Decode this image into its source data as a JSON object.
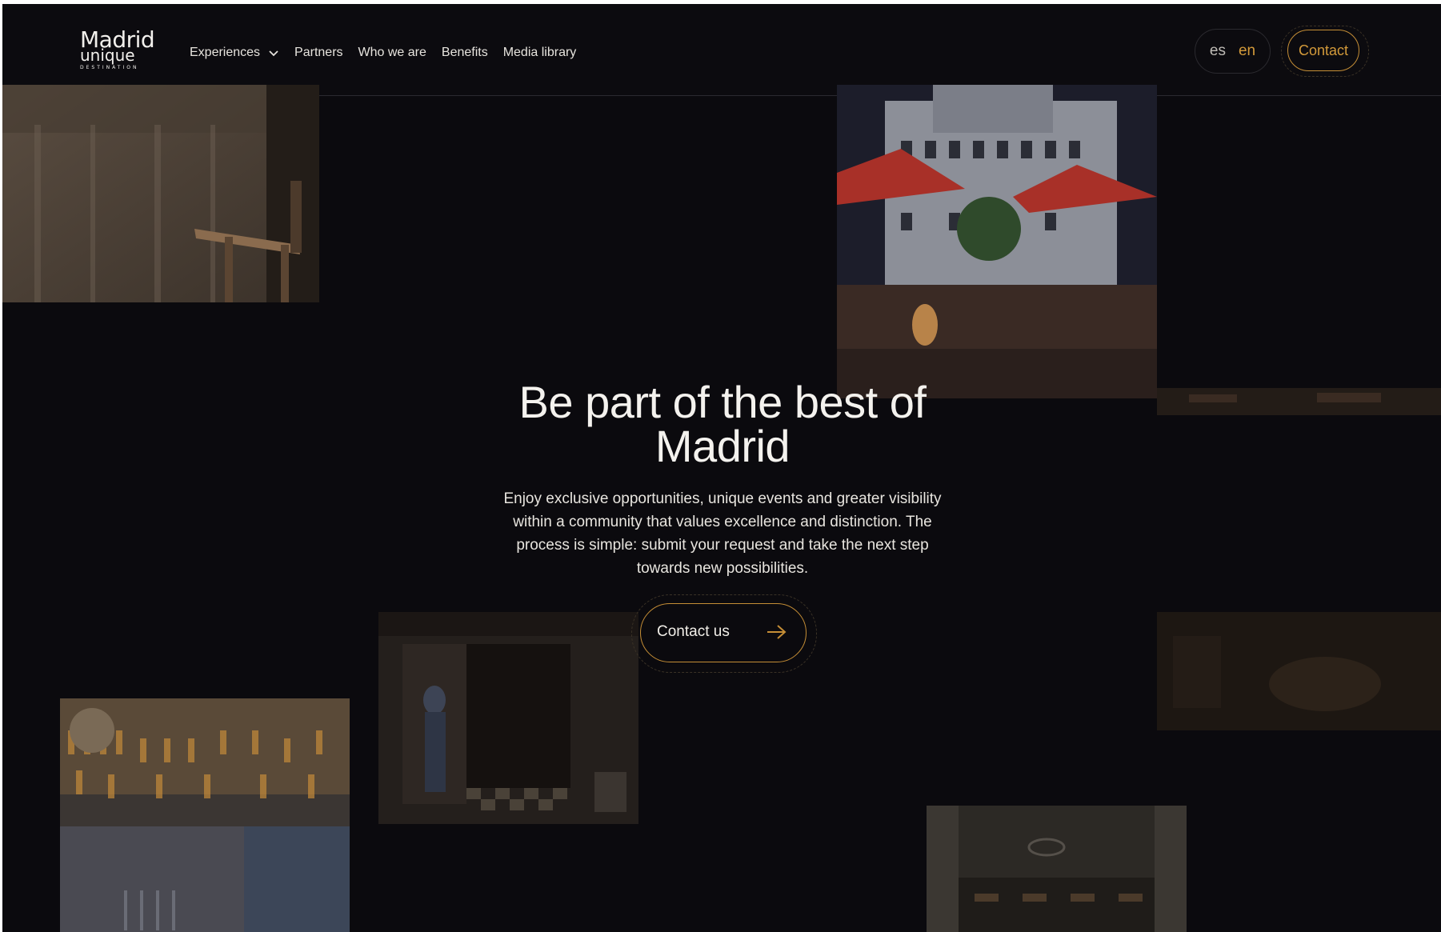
{
  "logo": {
    "main": "Madrid",
    "sub": "unique",
    "tag": "DESTINATION"
  },
  "nav": {
    "experiences": "Experiences",
    "partners": "Partners",
    "who_we_are": "Who we are",
    "benefits": "Benefits",
    "media_library": "Media library"
  },
  "lang": {
    "es": "es",
    "en": "en",
    "active": "en"
  },
  "header": {
    "contact_label": "Contact"
  },
  "hero": {
    "title": "Be part of the best of Madrid",
    "description": "Enjoy exclusive opportunities, unique events and greater visibility within a community that values excellence and distinction. The process is simple: submit your request and take the next step towards new possibilities.",
    "cta_label": "Contact us"
  },
  "colors": {
    "background": "#0b0a0e",
    "accent": "#c58e36",
    "text": "#f4f2ee"
  },
  "icons": {
    "dropdown": "chevron-down-icon",
    "cta": "arrow-right-icon"
  }
}
